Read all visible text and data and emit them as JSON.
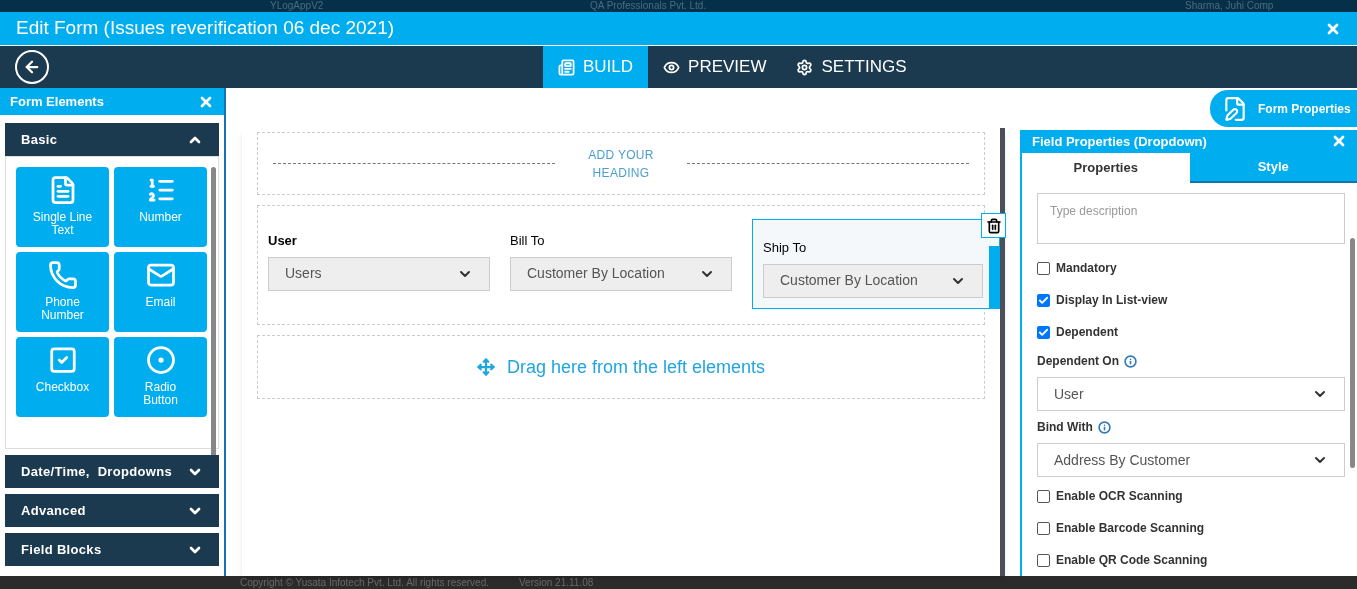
{
  "backdrop": {
    "app_name": "YLogAppV2",
    "company": "QA Professionals Pvt. Ltd.",
    "user": "Sharma, Juhi Comp",
    "copyright": "Copyright © Yusata Infotech Pvt. Ltd. All rights reserved.",
    "version": "Version 21.11.08"
  },
  "modal": {
    "title": "Edit Form (Issues reverification 06 dec 2021)"
  },
  "nav_tabs": [
    {
      "label": "BUILD",
      "selected": true
    },
    {
      "label": "PREVIEW",
      "selected": false
    },
    {
      "label": "SETTINGS",
      "selected": false
    }
  ],
  "form_elements": {
    "title": "Form Elements",
    "sections": [
      {
        "label": "Basic",
        "expanded": true,
        "items": [
          {
            "label": "Single Line Text"
          },
          {
            "label": "Number"
          },
          {
            "label": "Phone Number"
          },
          {
            "label": "Email"
          },
          {
            "label": "Checkbox"
          },
          {
            "label": "Radio Button"
          }
        ]
      },
      {
        "label": "Date/Time,  Dropdowns",
        "expanded": false
      },
      {
        "label": "Advanced",
        "expanded": false
      },
      {
        "label": "Field Blocks",
        "expanded": false
      }
    ]
  },
  "form_properties_button": "Form Properties",
  "canvas": {
    "heading": "ADD YOUR HEADING",
    "fields": [
      {
        "label": "User",
        "value": "Users",
        "selected": false
      },
      {
        "label": "Bill To",
        "value": "Customer By Location",
        "selected": false
      },
      {
        "label": "Ship To",
        "value": "Customer By Location",
        "selected": true
      }
    ],
    "drop_zone": "Drag here from the left elements"
  },
  "field_properties": {
    "title": "Field Properties (Dropdown)",
    "tabs": [
      {
        "label": "Properties",
        "selected": true
      },
      {
        "label": "Style",
        "selected": false
      }
    ],
    "items": [
      {
        "kind": "textarea",
        "placeholder": "Type description"
      },
      {
        "kind": "checkbox",
        "label": "Mandatory",
        "checked": false
      },
      {
        "kind": "checkbox",
        "label": "Display In List-view",
        "checked": true
      },
      {
        "kind": "checkbox",
        "label": "Dependent",
        "checked": true
      },
      {
        "kind": "select",
        "label": "Dependent On",
        "value": "User"
      },
      {
        "kind": "select",
        "label": "Bind With",
        "value": "Address By Customer"
      },
      {
        "kind": "checkbox",
        "label": "Enable OCR Scanning",
        "checked": false
      },
      {
        "kind": "checkbox",
        "label": "Enable Barcode Scanning",
        "checked": false
      },
      {
        "kind": "checkbox",
        "label": "Enable QR Code Scanning",
        "checked": false
      }
    ]
  }
}
